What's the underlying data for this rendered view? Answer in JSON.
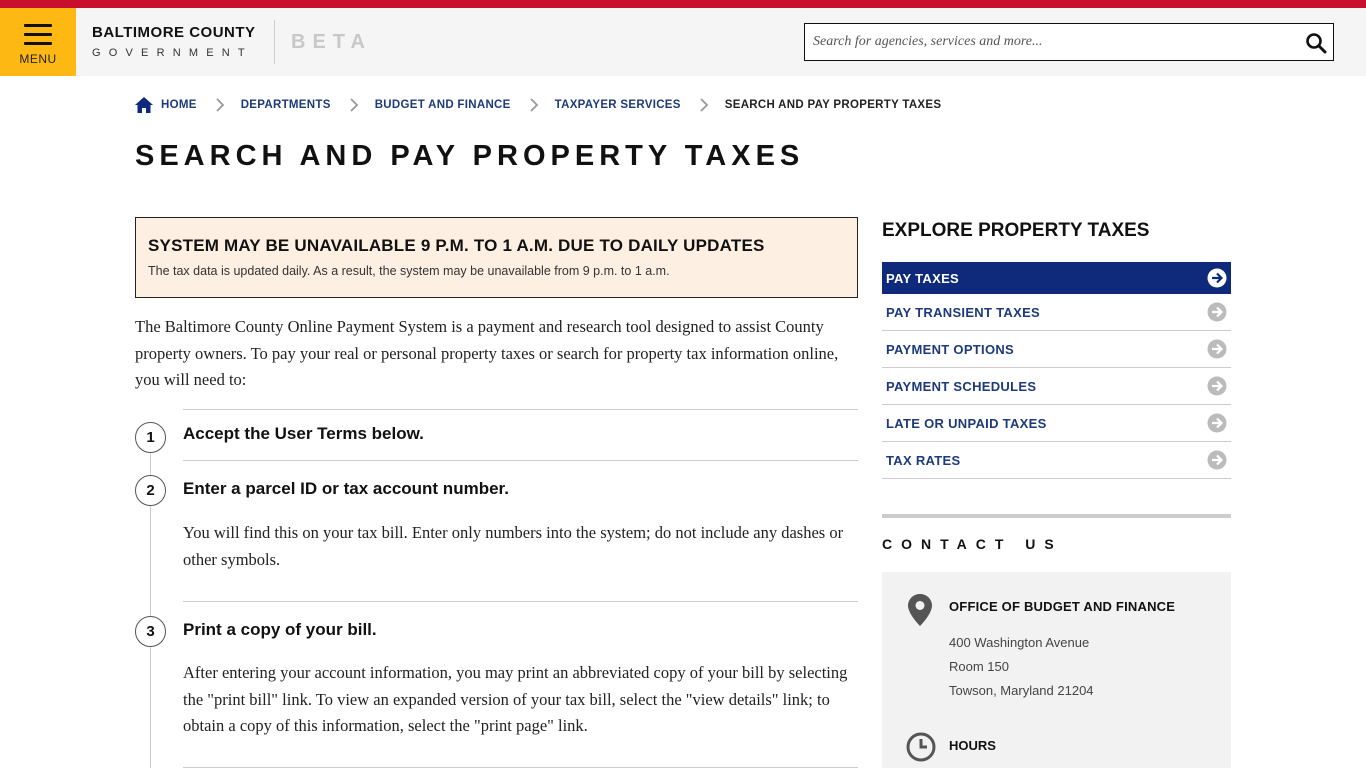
{
  "header": {
    "menu_label": "MENU",
    "brand_line1": "BALTIMORE COUNTY",
    "brand_line2": "GOVERNMENT",
    "beta": "BETA",
    "search_placeholder": "Search for agencies, services and more..."
  },
  "breadcrumb": {
    "items": [
      "HOME",
      "DEPARTMENTS",
      "BUDGET AND FINANCE",
      "TAXPAYER SERVICES",
      "SEARCH AND PAY PROPERTY TAXES"
    ]
  },
  "page": {
    "title": "SEARCH AND PAY PROPERTY TAXES"
  },
  "alert": {
    "title": "SYSTEM MAY BE UNAVAILABLE 9 P.M. TO 1 A.M. DUE TO DAILY UPDATES",
    "body": "The tax data is updated daily. As a result, the system may be unavailable from 9 p.m. to 1 a.m."
  },
  "intro": "The Baltimore County Online Payment System is a payment and research tool designed to assist County property owners. To pay your real or personal property taxes or search for property tax information online, you will need to:",
  "steps": [
    {
      "num": "1",
      "title": "Accept the User Terms below.",
      "text": ""
    },
    {
      "num": "2",
      "title": "Enter a parcel ID or tax account number.",
      "text": "You will find this on your tax bill. Enter only numbers into the system; do not include any dashes or other symbols."
    },
    {
      "num": "3",
      "title": "Print a copy of your bill.",
      "text": "After entering your account information, you may print an abbreviated copy of your bill by selecting the \"print bill\" link. To view an expanded version of your tax bill, select the \"view details\" link; to obtain a copy of this information, select the \"print page\" link."
    }
  ],
  "sidebar": {
    "title": "EXPLORE PROPERTY TAXES",
    "items": [
      {
        "label": "PAY TAXES"
      },
      {
        "label": "PAY TRANSIENT TAXES"
      },
      {
        "label": "PAYMENT OPTIONS"
      },
      {
        "label": "PAYMENT SCHEDULES"
      },
      {
        "label": "LATE OR UNPAID TAXES"
      },
      {
        "label": "TAX RATES"
      }
    ]
  },
  "contact": {
    "title": "CONTACT US",
    "office": "OFFICE OF BUDGET AND FINANCE",
    "address": [
      "400 Washington Avenue",
      "Room 150",
      "Towson, Maryland 21204"
    ],
    "hours_label": "HOURS"
  },
  "colors": {
    "brand_red": "#c8102e",
    "menu_yellow": "#fdb813",
    "nav_blue": "#0f2a7a",
    "link_blue": "#1d3a7c",
    "alert_bg": "#fdf0e3"
  },
  "icons": [
    "menu-icon",
    "search-icon",
    "home-icon",
    "chevron-right-icon",
    "arrow-circle-right-icon",
    "location-pin-icon",
    "clock-icon"
  ]
}
